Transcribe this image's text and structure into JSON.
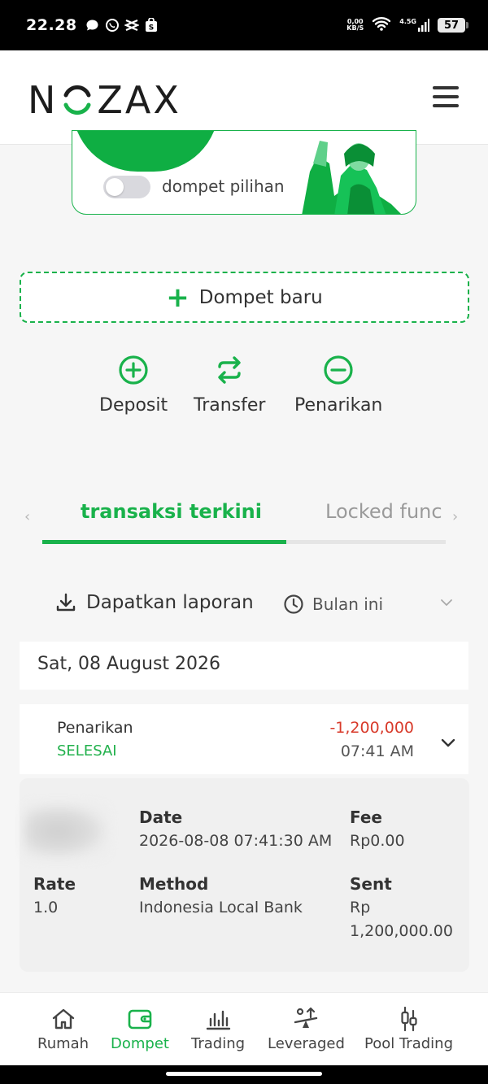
{
  "status_bar": {
    "time": "22.28",
    "net_speed_top": "0,00",
    "net_speed_bottom": "KB/S",
    "network_type": "4.5G",
    "battery": "57"
  },
  "header": {
    "logo_text": "NOZAX",
    "menu_icon": "hamburger-icon"
  },
  "wallet_card": {
    "toggle_label": "dompet pilihan",
    "toggle_on": false
  },
  "new_wallet": {
    "label": "Dompet baru"
  },
  "actions": [
    {
      "label": "Deposit",
      "icon": "plus-circle-icon"
    },
    {
      "label": "Transfer",
      "icon": "transfer-icon"
    },
    {
      "label": "Penarikan",
      "icon": "minus-circle-icon"
    }
  ],
  "tabs": {
    "active": "transaksi terkini",
    "next": "Locked func"
  },
  "report": {
    "label": "Dapatkan laporan",
    "period": "Bulan ini"
  },
  "date_header": "Sat, 08 August 2026",
  "transaction": {
    "type": "Penarikan",
    "status": "SELESAI",
    "amount": "-1,200,000",
    "time": "07:41 AM",
    "details": {
      "date_label": "Date",
      "date_value": "2026-08-08 07:41:30 AM",
      "fee_label": "Fee",
      "fee_value": "Rp0.00",
      "rate_label": "Rate",
      "rate_value": "1.0",
      "method_label": "Method",
      "method_value": "Indonesia Local Bank",
      "sent_label": "Sent",
      "sent_value_line1": "Rp",
      "sent_value_line2": "1,200,000.00"
    }
  },
  "bottom_nav": [
    {
      "label": "Rumah",
      "icon": "home-icon",
      "active": false
    },
    {
      "label": "Dompet",
      "icon": "wallet-icon",
      "active": true
    },
    {
      "label": "Trading",
      "icon": "bar-chart-icon",
      "active": false
    },
    {
      "label": "Leveraged",
      "icon": "leverage-icon",
      "active": false
    },
    {
      "label": "Pool Trading",
      "icon": "candlestick-icon",
      "active": false
    }
  ],
  "colors": {
    "brand_green": "#19b24b",
    "negative_red": "#d83a2a"
  }
}
